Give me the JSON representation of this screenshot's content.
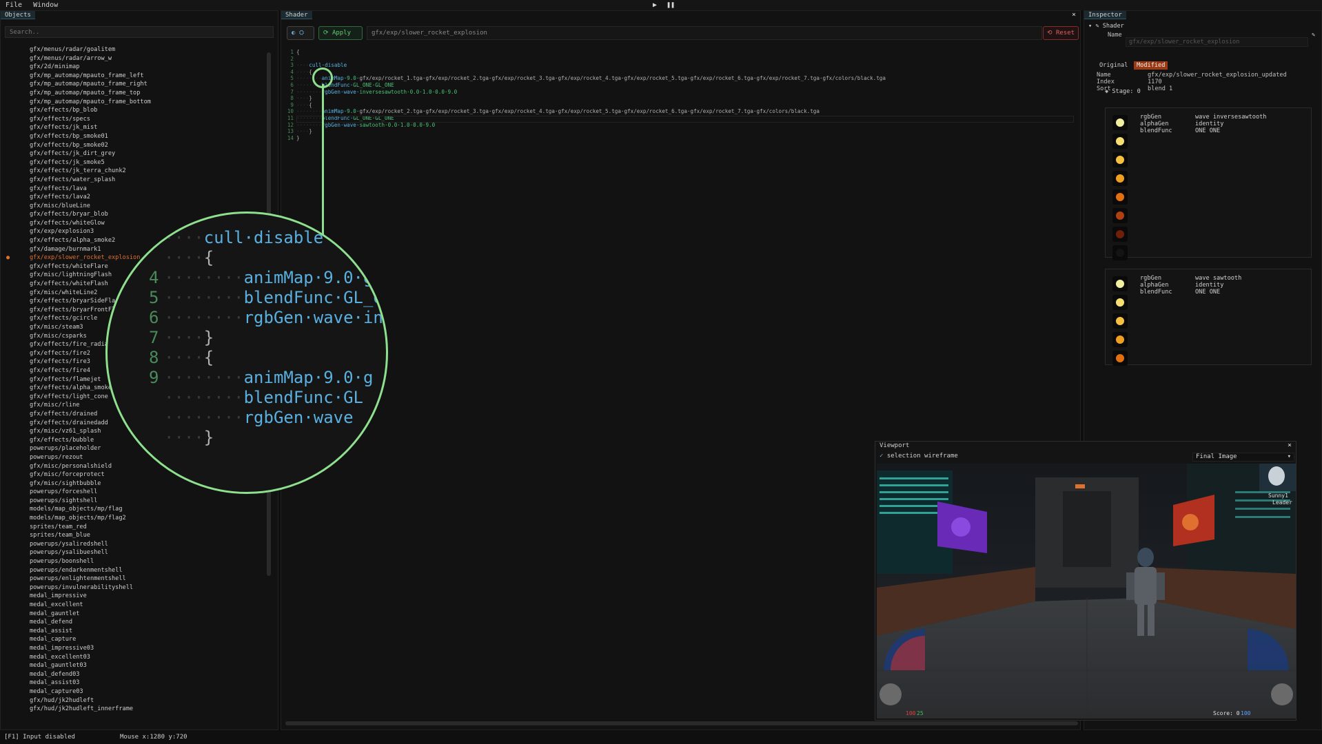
{
  "menu": {
    "file": "File",
    "window": "Window"
  },
  "transport": {
    "play": "▶",
    "pause": "❚❚"
  },
  "objects_panel": {
    "tab": "Objects",
    "search_placeholder": "Search..",
    "items": [
      "gfx/menus/radar/goalitem",
      "gfx/menus/radar/arrow_w",
      "gfx/2d/minimap",
      "gfx/mp_automap/mpauto_frame_left",
      "gfx/mp_automap/mpauto_frame_right",
      "gfx/mp_automap/mpauto_frame_top",
      "gfx/mp_automap/mpauto_frame_bottom",
      "gfx/effects/bp_blob",
      "gfx/effects/specs",
      "gfx/effects/jk_mist",
      "gfx/effects/bp_smoke01",
      "gfx/effects/bp_smoke02",
      "gfx/effects/jk_dirt_grey",
      "gfx/effects/jk_smoke5",
      "gfx/effects/jk_terra_chunk2",
      "gfx/effects/water_splash",
      "gfx/effects/lava",
      "gfx/effects/lava2",
      "gfx/misc/blueLine",
      "gfx/effects/bryar_blob",
      "gfx/effects/whiteGlow",
      "gfx/exp/explosion3",
      "gfx/effects/alpha_smoke2",
      "gfx/damage/burnmark1",
      "gfx/exp/slower_rocket_explosion",
      "gfx/effects/whiteFlare",
      "gfx/misc/lightningFlash",
      "gfx/effects/whiteFlash",
      "gfx/misc/whiteLine2",
      "gfx/effects/bryarSideFlash",
      "gfx/effects/bryarFrontFlash",
      "gfx/effects/gcircle",
      "gfx/misc/steam3",
      "gfx/misc/csparks",
      "gfx/effects/fire_radial",
      "gfx/effects/fire2",
      "gfx/effects/fire3",
      "gfx/effects/fire4",
      "gfx/effects/flamejet",
      "gfx/effects/alpha_smoke",
      "gfx/effects/light_cone",
      "gfx/misc/rline",
      "gfx/effects/drained",
      "gfx/effects/drainedadd",
      "gfx/misc/vz61_splash",
      "gfx/effects/bubble",
      "powerups/placeholder",
      "powerups/rezout",
      "gfx/misc/personalshield",
      "gfx/misc/forceprotect",
      "gfx/misc/sightbubble",
      "powerups/forceshell",
      "powerups/sightshell",
      "models/map_objects/mp/flag",
      "models/map_objects/mp/flag2",
      "sprites/team_red",
      "sprites/team_blue",
      "powerups/ysaliredshell",
      "powerups/ysalibueshell",
      "powerups/boonshell",
      "powerups/endarkenmentshell",
      "powerups/enlightenmentshell",
      "powerups/invulnerabilityshell",
      "medal_impressive",
      "medal_excellent",
      "medal_gauntlet",
      "medal_defend",
      "medal_assist",
      "medal_capture",
      "medal_impressive03",
      "medal_excellent03",
      "medal_gauntlet03",
      "medal_defend03",
      "medal_assist03",
      "medal_capture03",
      "gfx/hud/jk2hudleft",
      "gfx/hud/jk2hudleft_innerframe"
    ],
    "selected_index": 24
  },
  "shader_panel": {
    "tab": "Shader",
    "close": "×",
    "apply_label": "Apply",
    "path": "gfx/exp/slower_rocket_explosion",
    "reset_label": "Reset",
    "code": [
      {
        "n": "1",
        "dots": "",
        "a": "{",
        "b": "",
        "c": ""
      },
      {
        "n": "2",
        "dots": "",
        "a": "",
        "b": "",
        "c": ""
      },
      {
        "n": "3",
        "dots": "····",
        "a": "cull·disable",
        "b": "",
        "c": ""
      },
      {
        "n": "4",
        "dots": "····",
        "a": "{",
        "b": "",
        "c": ""
      },
      {
        "n": "5",
        "dots": "········",
        "a": "animMap·",
        "b": "9.0·",
        "c": "gfx/exp/rocket_1.tga·gfx/exp/rocket_2.tga·gfx/exp/rocket_3.tga·gfx/exp/rocket_4.tga·gfx/exp/rocket_5.tga·gfx/exp/rocket_6.tga·gfx/exp/rocket_7.tga·gfx/colors/black.tga"
      },
      {
        "n": "6",
        "dots": "········",
        "a": "blendFunc·",
        "b": "GL_ONE·GL_ONE",
        "c": ""
      },
      {
        "n": "7",
        "dots": "········",
        "a": "rgbGen·wave·",
        "b": "inversesawtooth·0.0·1.0·0.0·9.0",
        "c": ""
      },
      {
        "n": "8",
        "dots": "····",
        "a": "}",
        "b": "",
        "c": ""
      },
      {
        "n": "9",
        "dots": "····",
        "a": "{",
        "b": "",
        "c": ""
      },
      {
        "n": "10",
        "dots": "········",
        "a": "animMap·",
        "b": "9.0·",
        "c": "gfx/exp/rocket_2.tga·gfx/exp/rocket_3.tga·gfx/exp/rocket_4.tga·gfx/exp/rocket_5.tga·gfx/exp/rocket_6.tga·gfx/exp/rocket_7.tga·gfx/colors/black.tga"
      },
      {
        "n": "11",
        "dots": "········",
        "a": "blendFunc·",
        "b": "GL_ONE·GL_ONE",
        "c": ""
      },
      {
        "n": "12",
        "dots": "········",
        "a": "rgbGen·wave·",
        "b": "sawtooth·0.0·1.0·0.0·9.0",
        "c": ""
      },
      {
        "n": "13",
        "dots": "····",
        "a": "}",
        "b": "",
        "c": ""
      },
      {
        "n": "14",
        "dots": "",
        "a": "}",
        "b": "",
        "c": ""
      }
    ]
  },
  "magnifier": {
    "rows": [
      {
        "ln": "",
        "dots": "",
        "text": "{",
        "cls": "txt"
      },
      {
        "ln": "",
        "dots": "····",
        "text": "cull·disable",
        "cls": "kw"
      },
      {
        "ln": "",
        "dots": "····",
        "text": "{",
        "cls": "txt"
      },
      {
        "ln": "4",
        "dots": "········",
        "text": "animMap·9.0·g",
        "cls": "kw"
      },
      {
        "ln": "5",
        "dots": "········",
        "text": "blendFunc·GL_O",
        "cls": "kw"
      },
      {
        "ln": "6",
        "dots": "········",
        "text": "rgbGen·wave·in",
        "cls": "kw"
      },
      {
        "ln": "7",
        "dots": "····",
        "text": "}",
        "cls": "txt"
      },
      {
        "ln": "8",
        "dots": "····",
        "text": "{",
        "cls": "txt"
      },
      {
        "ln": "9",
        "dots": "········",
        "text": "animMap·9.0·g",
        "cls": "kw"
      },
      {
        "ln": "",
        "dots": "········",
        "text": "blendFunc·GL",
        "cls": "kw"
      },
      {
        "ln": "",
        "dots": "········",
        "text": "rgbGen·wave",
        "cls": "kw"
      },
      {
        "ln": "",
        "dots": "····",
        "text": "}",
        "cls": "txt"
      }
    ]
  },
  "inspector": {
    "tab": "Inspector",
    "section": "Shader",
    "name_label": "Name",
    "name_value": "gfx/exp/slower_rocket_explosion",
    "tab_original": "Original",
    "tab_modified": "Modified",
    "fields": [
      {
        "k": "Name",
        "v": "gfx/exp/slower_rocket_explosion_updated"
      },
      {
        "k": "Index",
        "v": "1170"
      },
      {
        "k": "Sort",
        "v": "blend 1"
      }
    ],
    "stage_label": "Stage: 0",
    "stages": [
      {
        "props": [
          {
            "k": "rgbGen",
            "v": "wave inversesawtooth"
          },
          {
            "k": "alphaGen",
            "v": "identity"
          },
          {
            "k": "blendFunc",
            "v": "ONE ONE"
          }
        ],
        "frames": 8
      },
      {
        "props": [
          {
            "k": "rgbGen",
            "v": "wave sawtooth"
          },
          {
            "k": "alphaGen",
            "v": "identity"
          },
          {
            "k": "blendFunc",
            "v": "ONE ONE"
          }
        ],
        "frames": 5
      }
    ]
  },
  "viewport": {
    "tab": "Viewport",
    "close": "×",
    "checkbox_label": "selection wireframe",
    "select_value": "Final Image",
    "hud_score": "Score: 0",
    "hud_health": "100",
    "hud_armor": "25",
    "hud_ammo": "100",
    "player_name": "Sunny1",
    "player_caption": "Leader"
  },
  "status": {
    "input": "[F1] Input disabled",
    "mouse": "Mouse x:1280 y:720"
  },
  "colors": {
    "accent_green": "#8ee08e",
    "selected_orange": "#e07030",
    "keyword_blue": "#59b0e0",
    "reset_red": "#e06060"
  }
}
